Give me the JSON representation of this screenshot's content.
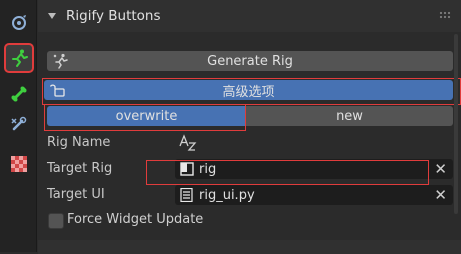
{
  "panel": {
    "title": "Rigify Buttons"
  },
  "buttons": {
    "generate_rig": "Generate Rig",
    "advanced_options": "高级选项",
    "overwrite": "overwrite",
    "new": "new"
  },
  "fields": {
    "rig_name_label": "Rig Name",
    "rig_name_value": "",
    "target_rig_label": "Target Rig",
    "target_rig_value": "rig",
    "target_ui_label": "Target UI",
    "target_ui_value": "rig_ui.py"
  },
  "checkbox": {
    "force_widget_update": "Force Widget Update"
  },
  "colors": {
    "accent_blue": "#4772b3",
    "highlight_red": "#e03c3c",
    "active_tab_icon": "#3fcf3f"
  },
  "icons": {
    "tabs": [
      "object-icon",
      "armature-pose-icon",
      "bone-icon",
      "bone-constraint-icon",
      "texture-checker-icon"
    ]
  }
}
